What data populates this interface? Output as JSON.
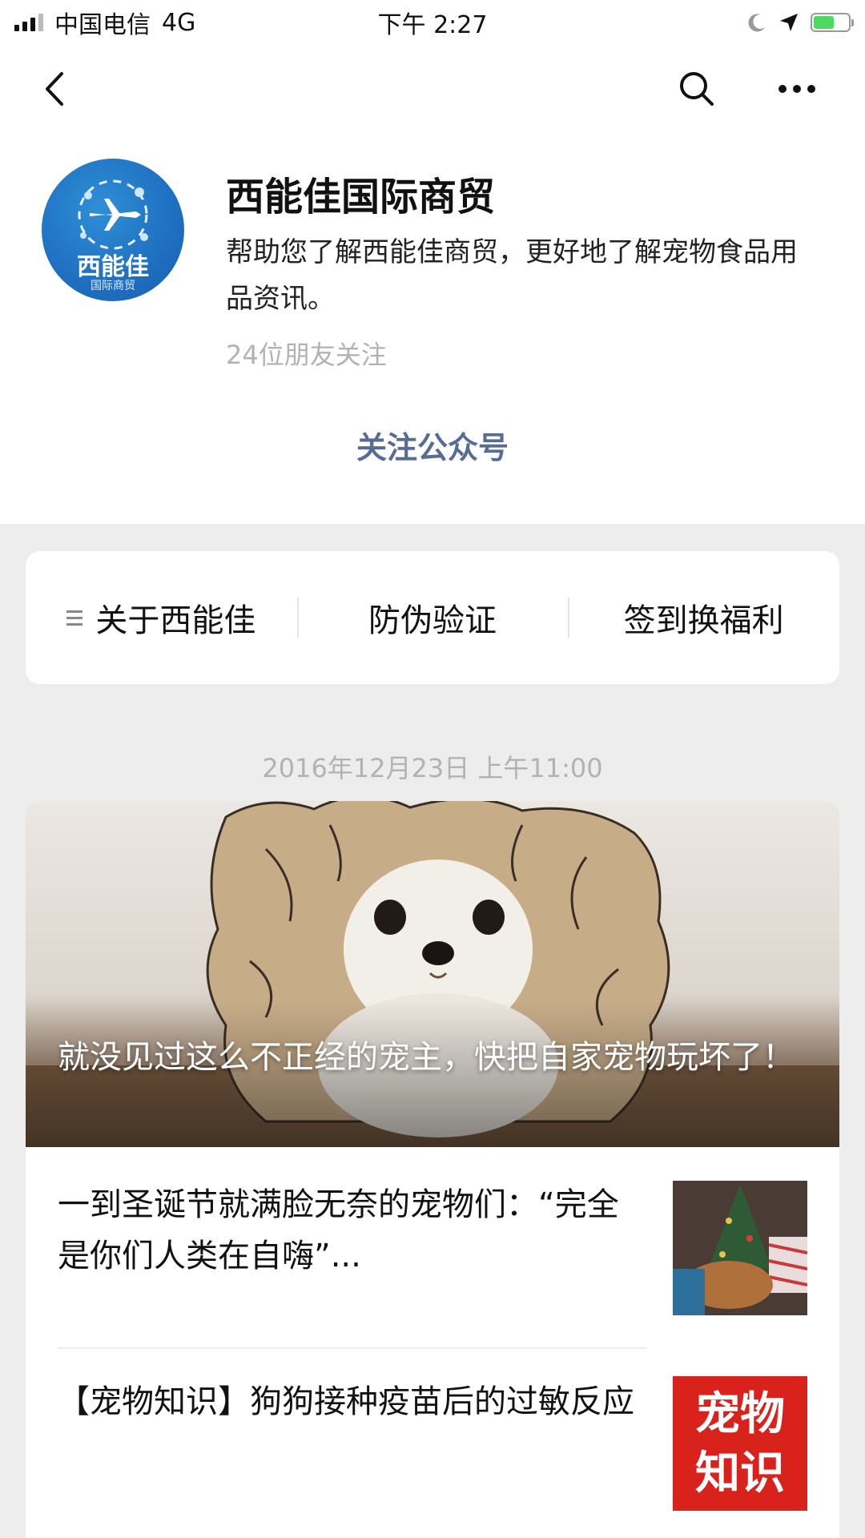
{
  "status_bar": {
    "carrier": "中国电信",
    "network": "4G",
    "time": "下午 2:27",
    "icons": [
      "signal-icon",
      "moon-icon",
      "location-icon",
      "battery-icon"
    ]
  },
  "nav": {
    "icons": [
      "back-arrow-icon",
      "search-icon",
      "more-icon"
    ]
  },
  "profile": {
    "logo_text": "西能佳",
    "logo_subtext": "国际商贸",
    "name": "西能佳国际商贸",
    "description": "帮助您了解西能佳商贸，更好地了解宠物食品用品资讯。",
    "followers": "24位朋友关注",
    "follow_button": "关注公众号"
  },
  "menu": {
    "items": [
      {
        "label": "关于西能佳",
        "has_submenu": true
      },
      {
        "label": "防伪验证",
        "has_submenu": false
      },
      {
        "label": "签到换福利",
        "has_submenu": false
      }
    ]
  },
  "feed": {
    "date": "2016年12月23日 上午11:00",
    "hero_title": "就没见过这么不正经的宠主，快把自家宠物玩坏了！",
    "articles": [
      {
        "title": "一到圣诞节就满脸无奈的宠物们：“完全是你们人类在自嗨”..."
      },
      {
        "title": "【宠物知识】狗狗接种疫苗后的过敏反应",
        "thumb_text": "宠物知识"
      }
    ]
  },
  "colors": {
    "link_blue": "#576b95",
    "gray_text": "#b2b2b2",
    "logo_blue": "#1f6fc0",
    "thumb_red": "#d9221c",
    "battery_green": "#4cd964"
  }
}
